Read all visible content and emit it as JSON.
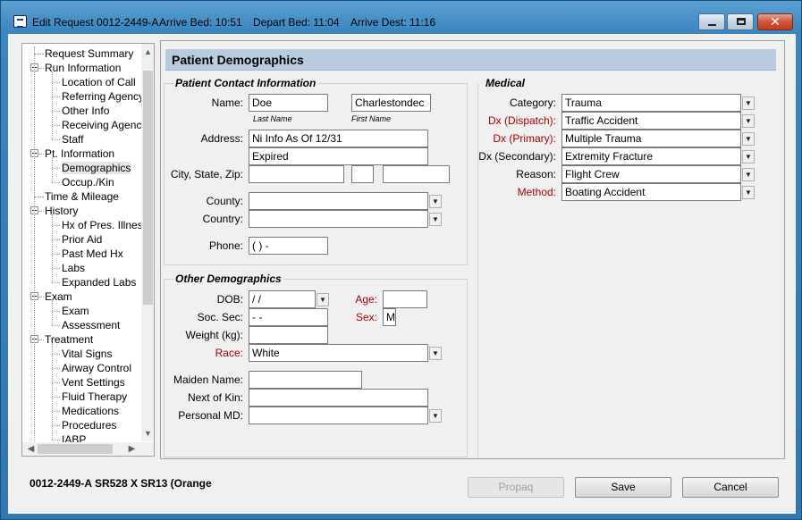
{
  "window": {
    "title": "Edit Request 0012-2449-A",
    "arrive_bed": "Arrive Bed: 10:51",
    "depart_bed": "Depart Bed: 11:04",
    "arrive_dest": "Arrive Dest: 11:16"
  },
  "tree": {
    "items": [
      {
        "label": "Request Summary",
        "level": 0,
        "expander": false
      },
      {
        "label": "Run Information",
        "level": 0,
        "expander": true
      },
      {
        "label": "Location of Call",
        "level": 1
      },
      {
        "label": "Referring Agency",
        "level": 1
      },
      {
        "label": "Other Info",
        "level": 1
      },
      {
        "label": "Receiving Agency",
        "level": 1
      },
      {
        "label": "Staff",
        "level": 1
      },
      {
        "label": "Pt. Information",
        "level": 0,
        "expander": true
      },
      {
        "label": "Demographics",
        "level": 1,
        "selected": true
      },
      {
        "label": "Occup./Kin",
        "level": 1
      },
      {
        "label": "Time & Mileage",
        "level": 0,
        "expander": false
      },
      {
        "label": "History",
        "level": 0,
        "expander": true
      },
      {
        "label": "Hx of Pres. Illness",
        "level": 1
      },
      {
        "label": "Prior Aid",
        "level": 1
      },
      {
        "label": "Past Med Hx",
        "level": 1
      },
      {
        "label": "Labs",
        "level": 1
      },
      {
        "label": "Expanded Labs",
        "level": 1
      },
      {
        "label": "Exam",
        "level": 0,
        "expander": true
      },
      {
        "label": "Exam",
        "level": 1
      },
      {
        "label": "Assessment",
        "level": 1
      },
      {
        "label": "Treatment",
        "level": 0,
        "expander": true
      },
      {
        "label": "Vital Signs",
        "level": 1
      },
      {
        "label": "Airway Control",
        "level": 1
      },
      {
        "label": "Vent Settings",
        "level": 1
      },
      {
        "label": "Fluid Therapy",
        "level": 1
      },
      {
        "label": "Medications",
        "level": 1
      },
      {
        "label": "Procedures",
        "level": 1
      },
      {
        "label": "IABP",
        "level": 1
      }
    ]
  },
  "section": {
    "title": "Patient Demographics"
  },
  "contact": {
    "title": "Patient Contact Information",
    "name_label": "Name:",
    "last_name": "Doe",
    "first_name": "Charlestondec",
    "last_name_caption": "Last Name",
    "first_name_caption": "First Name",
    "address_label": "Address:",
    "address1": "Ni Info As Of 12/31",
    "address2": "Expired",
    "csz_label": "City, State, Zip:",
    "city": "",
    "state": "",
    "zip": "",
    "county_label": "County:",
    "county": "",
    "country_label": "Country:",
    "country": "",
    "phone_label": "Phone:",
    "phone": "(   )    -"
  },
  "other": {
    "title": "Other Demographics",
    "dob_label": "DOB:",
    "dob": "  /  /",
    "age_label": "Age:",
    "age": "",
    "ssn_label": "Soc. Sec:",
    "ssn": "    -  -",
    "sex_label": "Sex:",
    "sex": "M",
    "weight_label": "Weight (kg):",
    "weight": "",
    "race_label": "Race:",
    "race": "White",
    "maiden_label": "Maiden Name:",
    "maiden": "",
    "kin_label": "Next of Kin:",
    "kin": "",
    "md_label": "Personal MD:",
    "md": ""
  },
  "medical": {
    "title": "Medical",
    "category_label": "Category:",
    "category": "Trauma",
    "dx_dispatch_label": "Dx (Dispatch):",
    "dx_dispatch": "Traffic Accident",
    "dx_primary_label": "Dx (Primary):",
    "dx_primary": "Multiple Trauma",
    "dx_secondary_label": "Dx (Secondary):",
    "dx_secondary": "Extremity Fracture",
    "reason_label": "Reason:",
    "reason": "Flight Crew",
    "method_label": "Method:",
    "method": "Boating Accident"
  },
  "footer": {
    "status": "0012-2449-A    SR528 X SR13 (Orange",
    "propaq": "Propaq",
    "save": "Save",
    "cancel": "Cancel"
  },
  "colors": {
    "title_bar": "#3b86bf",
    "section_header": "#b8cbe0",
    "required_label": "#b00000"
  }
}
